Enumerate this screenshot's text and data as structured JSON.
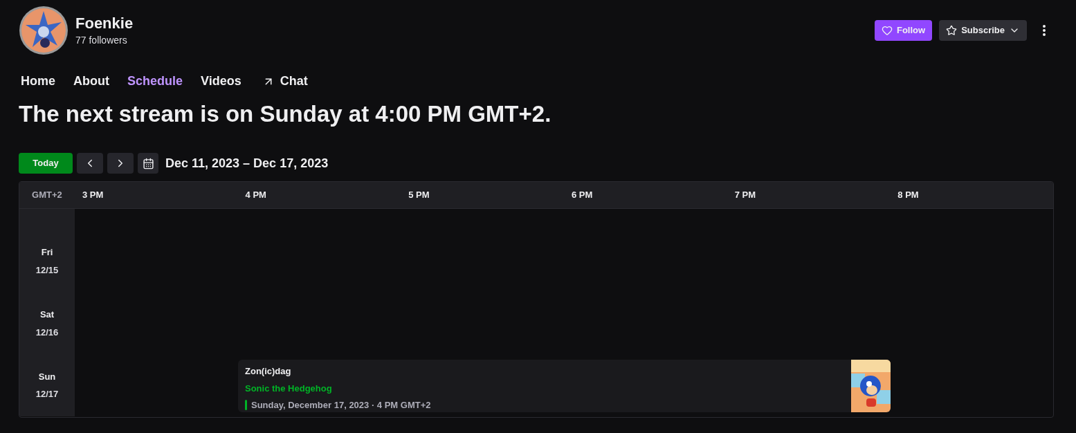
{
  "channel": {
    "name": "Foenkie",
    "followers": "77 followers"
  },
  "actions": {
    "follow": "Follow",
    "subscribe": "Subscribe"
  },
  "nav": [
    {
      "label": "Home",
      "selected": false,
      "kind": "tab"
    },
    {
      "label": "About",
      "selected": false,
      "kind": "tab"
    },
    {
      "label": "Schedule",
      "selected": true,
      "kind": "tab"
    },
    {
      "label": "Videos",
      "selected": false,
      "kind": "tab"
    },
    {
      "label": "Chat",
      "selected": false,
      "kind": "external"
    }
  ],
  "heading": "The next stream is on Sunday at 4:00 PM GMT+2.",
  "toolbar": {
    "today": "Today",
    "range": "Dec 11, 2023 – Dec 17, 2023"
  },
  "calendar": {
    "timezone": "GMT+2",
    "hours": [
      "3 PM",
      "4 PM",
      "5 PM",
      "6 PM",
      "7 PM",
      "8 PM"
    ],
    "days": [
      {
        "day": "Fri",
        "date": "12/15"
      },
      {
        "day": "Sat",
        "date": "12/16"
      },
      {
        "day": "Sun",
        "date": "12/17",
        "event": {
          "title": "Zon(ic)dag",
          "category": "Sonic the Hedgehog",
          "when": "Sunday, December 17, 2023 · 4 PM GMT+2",
          "color": "#00b326"
        }
      }
    ]
  }
}
